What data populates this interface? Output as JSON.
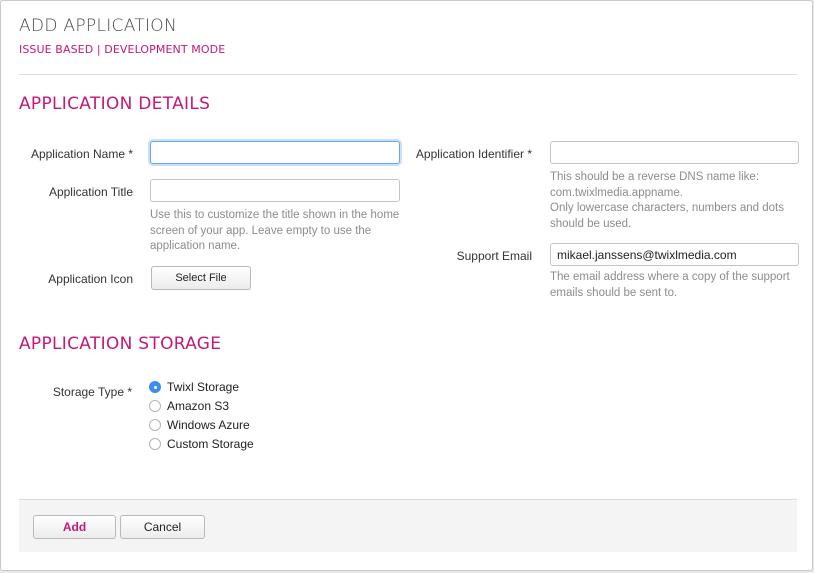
{
  "header": {
    "title": "ADD APPLICATION",
    "subtitle": "ISSUE BASED | DEVELOPMENT MODE"
  },
  "details": {
    "heading": "APPLICATION DETAILS",
    "app_name": {
      "label": "Application Name *",
      "value": "",
      "placeholder": ""
    },
    "app_title": {
      "label": "Application Title",
      "value": "",
      "placeholder": "",
      "help": [
        "Use this to customize the title shown in the home",
        "screen of your app. Leave empty to use the",
        "application name."
      ]
    },
    "app_icon": {
      "label": "Application Icon",
      "button": "Select File"
    },
    "app_identifier": {
      "label": "Application Identifier *",
      "value": "",
      "placeholder": "",
      "help": [
        "This should be a reverse DNS name like:",
        "com.twixlmedia.appname.",
        "Only lowercase characters, numbers and dots",
        "should be used."
      ]
    },
    "support_email": {
      "label": "Support Email",
      "value": "mikael.janssens@twixlmedia.com",
      "placeholder": "",
      "help": [
        "The email address where a copy of the support",
        "emails should be sent to."
      ]
    }
  },
  "storage": {
    "heading": "APPLICATION STORAGE",
    "label": "Storage Type *",
    "options": [
      {
        "label": "Twixl Storage",
        "checked": true
      },
      {
        "label": "Amazon S3",
        "checked": false
      },
      {
        "label": "Windows Azure",
        "checked": false
      },
      {
        "label": "Custom Storage",
        "checked": false
      }
    ]
  },
  "footer": {
    "add_label": "Add",
    "cancel_label": "Cancel"
  },
  "colors": {
    "accent": "#c2187a",
    "radio_selected": "#3b8eea",
    "focus": "#6aa6e8"
  }
}
